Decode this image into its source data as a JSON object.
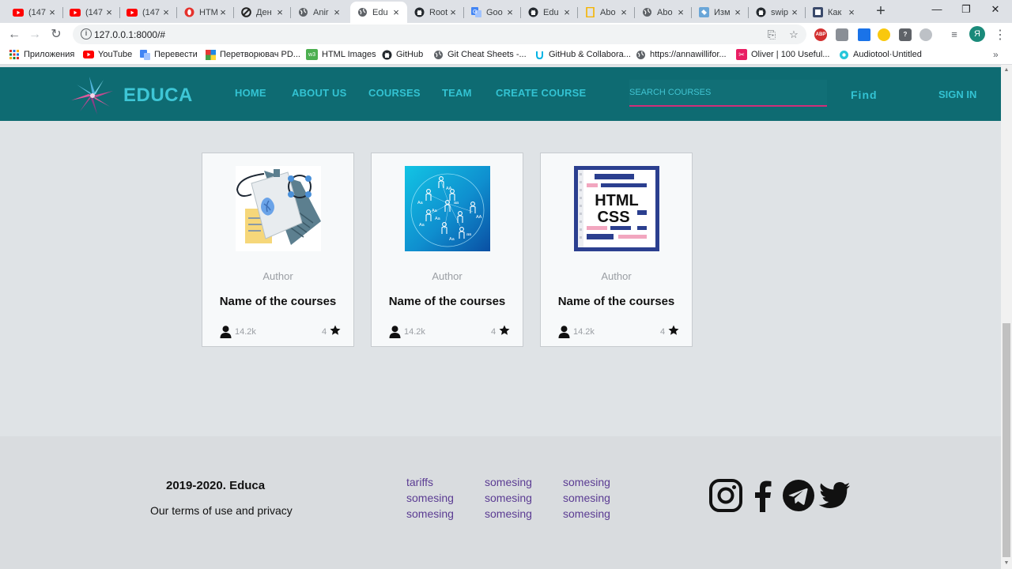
{
  "browser": {
    "tabs": [
      {
        "label": "(147",
        "icon": "youtube-icon"
      },
      {
        "label": "(147",
        "icon": "youtube-icon"
      },
      {
        "label": "(147",
        "icon": "youtube-icon"
      },
      {
        "label": "HTM",
        "icon": "opera-icon"
      },
      {
        "label": "Ден",
        "icon": "circle-slash-icon"
      },
      {
        "label": "Anir",
        "icon": "globe-icon"
      },
      {
        "label": "Edu",
        "icon": "globe-icon",
        "active": true
      },
      {
        "label": "Root",
        "icon": "github-icon"
      },
      {
        "label": "Goo",
        "icon": "translate-icon"
      },
      {
        "label": "Edu",
        "icon": "github-icon"
      },
      {
        "label": "Abo",
        "icon": "bookmark-icon"
      },
      {
        "label": "Abo",
        "icon": "globe-icon"
      },
      {
        "label": "Изм",
        "icon": "puzzle-icon"
      },
      {
        "label": "swip",
        "icon": "github-icon"
      },
      {
        "label": "Как",
        "icon": "app-icon"
      }
    ],
    "url": "127.0.0.1:8000/#",
    "profile_initial": "Я",
    "ext_abp": "ABP",
    "bookmarks": [
      {
        "label": "Приложения",
        "icon": "apps-grid-icon"
      },
      {
        "label": "YouTube",
        "icon": "youtube-icon"
      },
      {
        "label": "Перевести",
        "icon": "translate-icon"
      },
      {
        "label": "Перетворювач PD...",
        "icon": "pdf-converter-icon"
      },
      {
        "label": "HTML Images",
        "icon": "w3schools-icon"
      },
      {
        "label": "GitHub",
        "icon": "github-icon"
      },
      {
        "label": "Git Cheat Sheets -...",
        "icon": "globe-icon"
      },
      {
        "label": "GitHub & Collabora...",
        "icon": "udacity-icon"
      },
      {
        "label": "https://annawillifor...",
        "icon": "globe-icon"
      },
      {
        "label": "Oliver | 100 Useful...",
        "icon": "scissors-icon"
      },
      {
        "label": "Audiotool·Untitled",
        "icon": "audiotool-icon"
      }
    ]
  },
  "site": {
    "brand": "EDUCA",
    "nav": [
      "HOME",
      "ABOUT US",
      "COURSES",
      "TEAM",
      "CREATE COURSE"
    ],
    "search_placeholder": "SEARCH COURSES",
    "find_label": "Find",
    "signin_label": "SIGN IN",
    "colors": {
      "header": "#0e6b72",
      "accent": "#33c3d3",
      "underline": "#d12e79",
      "link": "#5b3c93"
    }
  },
  "courses": [
    {
      "author": "Author",
      "title": "Name of the courses",
      "views": "14.2k",
      "rating": "4",
      "image": "python-illustration"
    },
    {
      "author": "Author",
      "title": "Name of the courses",
      "views": "14.2k",
      "rating": "4",
      "image": "people-network-illustration"
    },
    {
      "author": "Author",
      "title": "Name of the courses",
      "views": "14.2k",
      "rating": "4",
      "image": "html-css-illustration",
      "image_text": [
        "HTML",
        "CSS"
      ]
    }
  ],
  "footer": {
    "copyright": "2019-2020. Educa",
    "terms": "Our terms of use and privacy",
    "columns": [
      [
        "tariffs",
        "somesing",
        "somesing"
      ],
      [
        "somesing",
        "somesing",
        "somesing"
      ],
      [
        "somesing",
        "somesing",
        "somesing"
      ]
    ],
    "social": [
      "instagram-icon",
      "facebook-icon",
      "telegram-icon",
      "twitter-icon"
    ]
  }
}
